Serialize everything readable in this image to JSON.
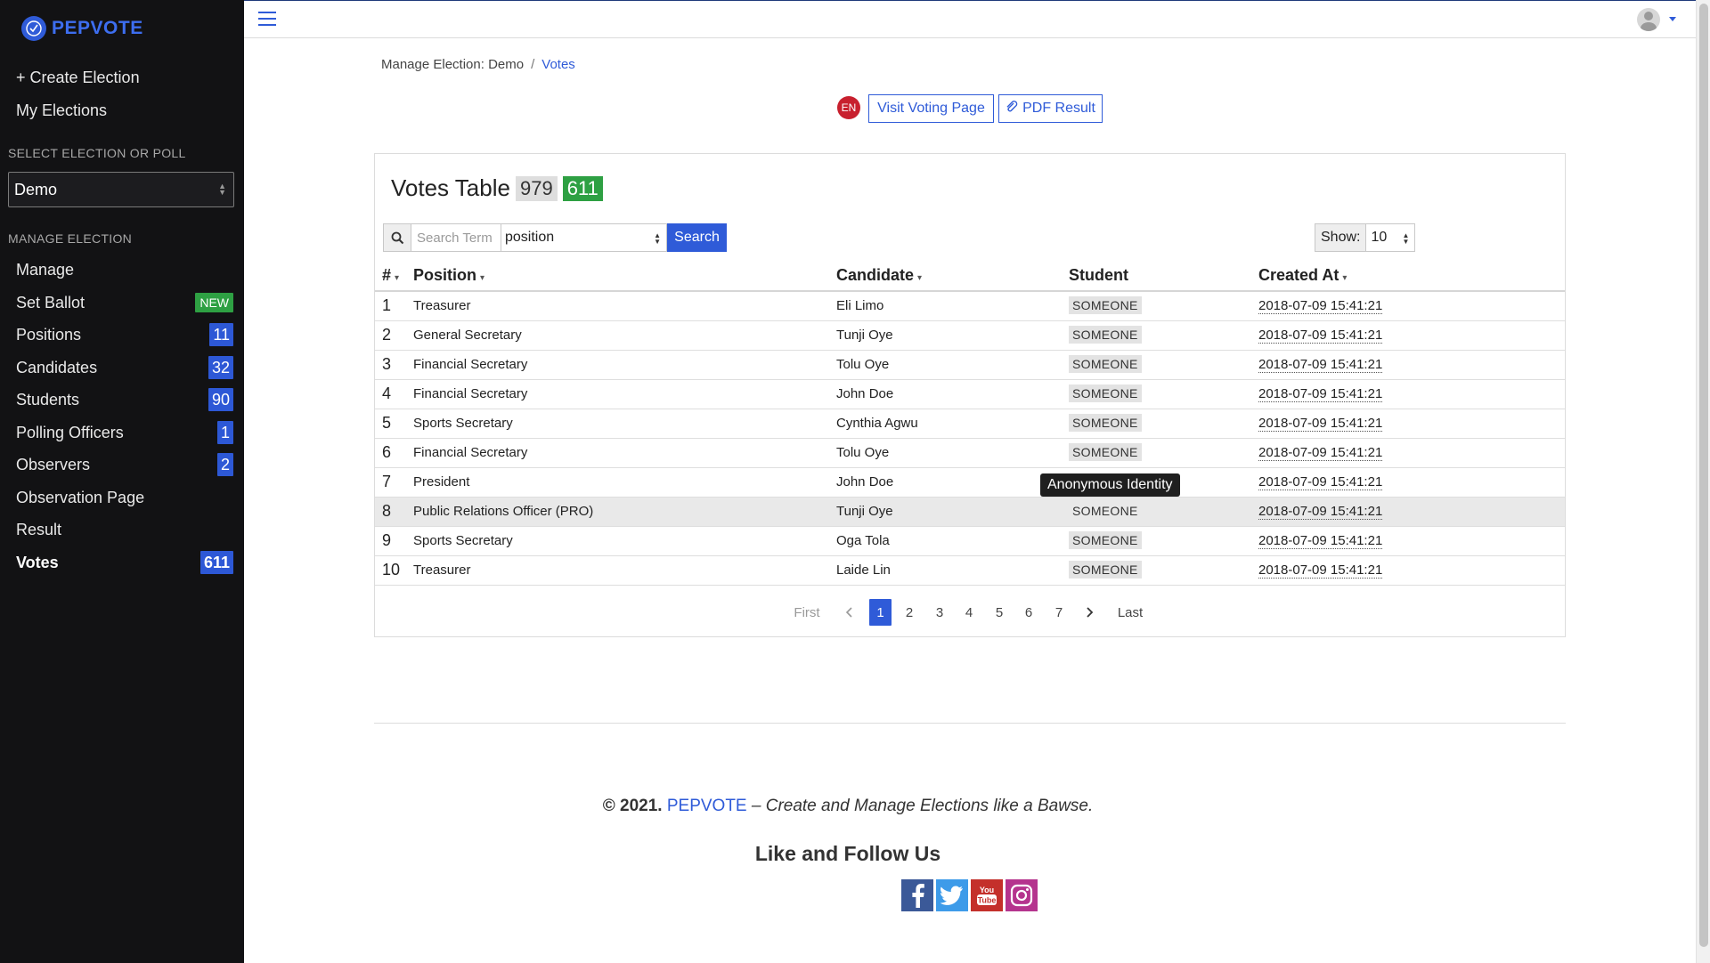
{
  "brand": {
    "name": "PEPVOTE"
  },
  "sidebar": {
    "create_election": "+ Create Election",
    "my_elections": "My Elections",
    "select_section": "SELECT ELECTION OR POLL",
    "selected_election": "Demo",
    "manage_section": "MANAGE ELECTION",
    "items": [
      {
        "label": "Manage",
        "badge": ""
      },
      {
        "label": "Set Ballot",
        "badge": "NEW"
      },
      {
        "label": "Positions",
        "badge": "11"
      },
      {
        "label": "Candidates",
        "badge": "32"
      },
      {
        "label": "Students",
        "badge": "90"
      },
      {
        "label": "Polling Officers",
        "badge": "1"
      },
      {
        "label": "Observers",
        "badge": "2"
      },
      {
        "label": "Observation Page",
        "badge": ""
      },
      {
        "label": "Result",
        "badge": ""
      },
      {
        "label": "Votes",
        "badge": "611"
      }
    ]
  },
  "breadcrumb": {
    "parent": "Manage Election: Demo",
    "separator": "/",
    "current": "Votes"
  },
  "actions": {
    "language": "EN",
    "visit_voting_page": "Visit Voting Page",
    "pdf_result": "PDF Result"
  },
  "votes_table": {
    "title": "Votes Table",
    "total_count": "979",
    "vote_count": "611",
    "search_placeholder": "Search Term",
    "search_field": "position",
    "search_button": "Search",
    "show_label": "Show:",
    "show_value": "10",
    "columns": [
      "#",
      "Position",
      "Candidate",
      "Student",
      "Created At"
    ],
    "rows": [
      {
        "n": "1",
        "position": "Treasurer",
        "candidate": "Eli Limo",
        "student": "SOMEONE",
        "created": "2018-07-09 15:41:21"
      },
      {
        "n": "2",
        "position": "General Secretary",
        "candidate": "Tunji Oye",
        "student": "SOMEONE",
        "created": "2018-07-09 15:41:21"
      },
      {
        "n": "3",
        "position": "Financial Secretary",
        "candidate": "Tolu Oye",
        "student": "SOMEONE",
        "created": "2018-07-09 15:41:21"
      },
      {
        "n": "4",
        "position": "Financial Secretary",
        "candidate": "John Doe",
        "student": "SOMEONE",
        "created": "2018-07-09 15:41:21"
      },
      {
        "n": "5",
        "position": "Sports Secretary",
        "candidate": "Cynthia Agwu",
        "student": "SOMEONE",
        "created": "2018-07-09 15:41:21"
      },
      {
        "n": "6",
        "position": "Financial Secretary",
        "candidate": "Tolu Oye",
        "student": "SOMEONE",
        "created": "2018-07-09 15:41:21"
      },
      {
        "n": "7",
        "position": "President",
        "candidate": "John Doe",
        "student": "",
        "created": "2018-07-09 15:41:21"
      },
      {
        "n": "8",
        "position": "Public Relations Officer (PRO)",
        "candidate": "Tunji Oye",
        "student": "SOMEONE",
        "created": "2018-07-09 15:41:21"
      },
      {
        "n": "9",
        "position": "Sports Secretary",
        "candidate": "Oga Tola",
        "student": "SOMEONE",
        "created": "2018-07-09 15:41:21"
      },
      {
        "n": "10",
        "position": "Treasurer",
        "candidate": "Laide Lin",
        "student": "SOMEONE",
        "created": "2018-07-09 15:41:21"
      }
    ],
    "tooltip": "Anonymous Identity",
    "pagination": {
      "first": "First",
      "last": "Last",
      "pages": [
        "1",
        "2",
        "3",
        "4",
        "5",
        "6",
        "7"
      ],
      "current": "1"
    }
  },
  "footer": {
    "copyright": "© 2021.",
    "brand": "PEPVOTE",
    "tagline": "– Create and Manage Elections like a Bawse.",
    "follow": "Like and Follow Us",
    "socials": [
      "facebook-icon",
      "twitter-icon",
      "youtube-icon",
      "instagram-icon"
    ]
  },
  "colors": {
    "accent": "#2f5bd8",
    "sidebar_bg": "#121214",
    "success": "#2ea043",
    "language_badge": "#c8202e"
  }
}
